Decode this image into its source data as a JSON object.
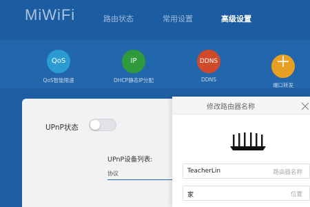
{
  "header": {
    "logo": "MiWiFi",
    "tabs": [
      {
        "label": "路由状态",
        "active": false
      },
      {
        "label": "常用设置",
        "active": false
      },
      {
        "label": "高级设置",
        "active": true
      }
    ]
  },
  "functions": [
    {
      "icon_text": "QoS",
      "label": "QoS智能限速",
      "color": "#2a9bd3",
      "icon": "qos-icon"
    },
    {
      "icon_text": "IP",
      "label": "DHCP静态IP分配",
      "color": "#2e9a3c",
      "icon": "ip-icon"
    },
    {
      "icon_text": "DDNS",
      "label": "DDNS",
      "color": "#cf4a2b",
      "icon": "ddns-icon"
    },
    {
      "icon_text": "",
      "label": "端口转发",
      "color": "#e8a024",
      "icon": "port-forward-icon"
    }
  ],
  "main": {
    "upnp_label": "UPnP状态",
    "upnp_enabled": false,
    "device_list_label": "UPnP设备列表:",
    "table_header": "协议"
  },
  "dialog": {
    "title": "修改路由器名称",
    "name_value": "TeacherLin",
    "name_placeholder": "路由器名称",
    "location_value": "家",
    "location_placeholder": "位置"
  },
  "colors": {
    "header_bg": "#1c5ca1",
    "accent": "#2266ab"
  }
}
